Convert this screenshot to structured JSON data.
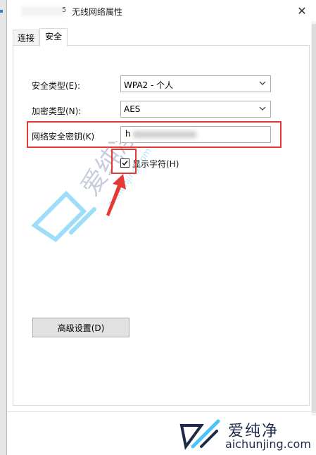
{
  "window": {
    "title": "无线网络属性",
    "title_glyph": "5",
    "close_symbol": "✕"
  },
  "tabs": [
    {
      "label": "连接",
      "active": false
    },
    {
      "label": "安全",
      "active": true
    }
  ],
  "security": {
    "type_label": "安全类型(E):",
    "type_value": "WPA2 - 个人",
    "encryption_label": "加密类型(N):",
    "encryption_value": "AES",
    "key_label": "网络安全密钥(K)",
    "key_value_visible": "h",
    "show_chars_label": "显示字符(H)",
    "show_chars_checked": true
  },
  "buttons": {
    "advanced": "高级设置(D)"
  },
  "watermark": {
    "line1": "爱纯净",
    "line2": "aichunjing.com"
  },
  "colors": {
    "highlight": "#e53935",
    "watermark_blue": "#4fc3f7",
    "watermark_dark": "#1e2a4a"
  }
}
